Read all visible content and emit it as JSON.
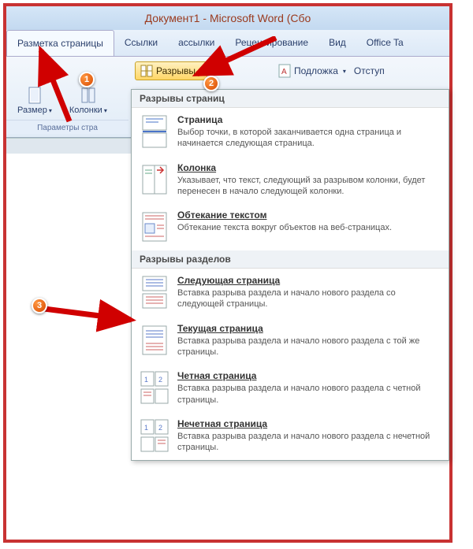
{
  "title": "Документ1 - Microsoft Word (Сбо",
  "tabs": {
    "layout": "Разметка страницы",
    "links": "Ссылки",
    "mailings": "ассылки",
    "review": "Рецензирование",
    "view": "Вид",
    "officetab": "Office Ta"
  },
  "ribbon": {
    "size": "Размер",
    "columns": "Колонки",
    "breaks": "Разрывы",
    "watermark": "Подложка",
    "indent": "Отступ",
    "group_params": "Параметры стра"
  },
  "markers": {
    "m1": "1",
    "m2": "2",
    "m3": "3"
  },
  "menu": {
    "hdr_page": "Разрывы страниц",
    "hdr_section": "Разрывы разделов",
    "items": {
      "page": {
        "title": "Страница",
        "desc": "Выбор точки, в которой заканчивается одна страница и начинается следующая страница."
      },
      "column": {
        "title": "Колонка",
        "desc": "Указывает, что текст, следующий за разрывом колонки, будет перенесен в начало следующей колонки."
      },
      "wrap": {
        "title": "Обтекание текстом",
        "desc": "Обтекание текста вокруг объектов на веб-страницах."
      },
      "next": {
        "title": "Следующая страница",
        "desc": "Вставка разрыва раздела и начало нового раздела со следующей страницы."
      },
      "current": {
        "title": "Текущая страница",
        "desc": "Вставка разрыва раздела и начало нового раздела с той же страницы."
      },
      "even": {
        "title": "Четная страница",
        "desc": "Вставка разрыва раздела и начало нового раздела с четной страницы."
      },
      "odd": {
        "title": "Нечетная страница",
        "desc": "Вставка разрыва раздела и начало нового раздела с нечетной страницы."
      }
    }
  }
}
